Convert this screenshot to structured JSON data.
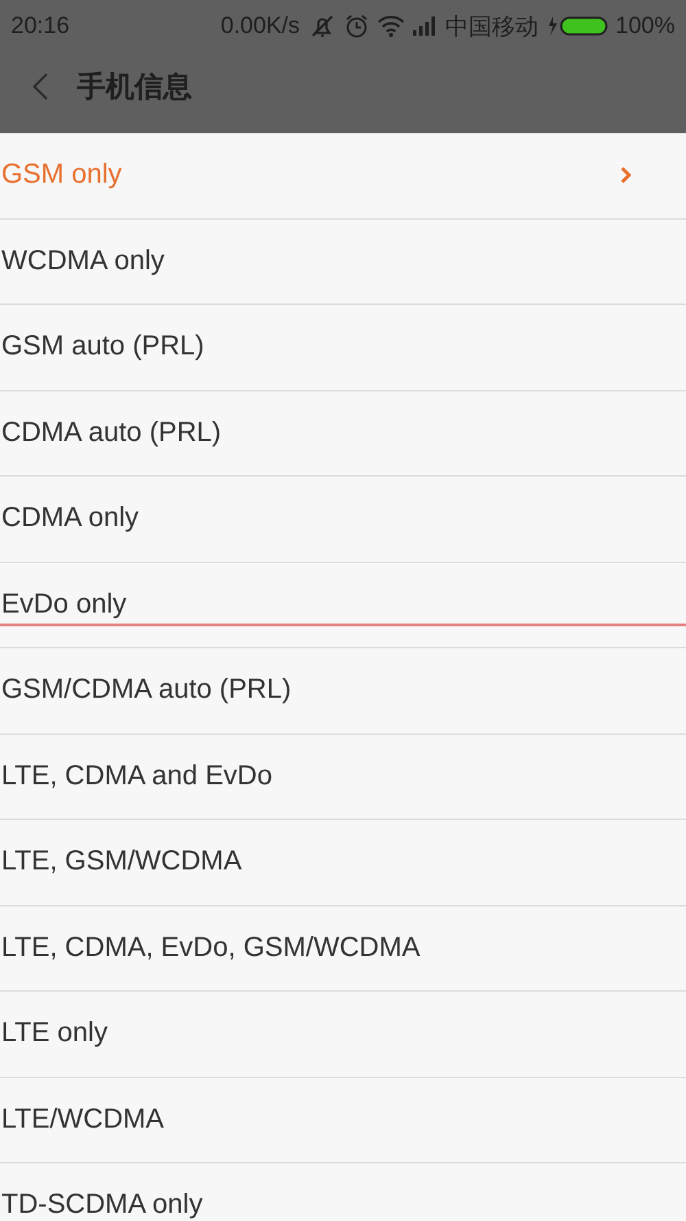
{
  "status_bar": {
    "time": "20:16",
    "speed": "0.00K/s",
    "carrier": "中国移动",
    "battery": "100%"
  },
  "header": {
    "title": "手机信息"
  },
  "options": [
    {
      "label": "GSM only",
      "selected": true
    },
    {
      "label": "WCDMA only",
      "selected": false
    },
    {
      "label": "GSM auto (PRL)",
      "selected": false
    },
    {
      "label": "CDMA auto (PRL)",
      "selected": false
    },
    {
      "label": "CDMA only",
      "selected": false
    },
    {
      "label": "EvDo only",
      "selected": false
    },
    {
      "label": "GSM/CDMA auto (PRL)",
      "selected": false
    },
    {
      "label": "LTE, CDMA and EvDo",
      "selected": false
    },
    {
      "label": "LTE, GSM/WCDMA",
      "selected": false
    },
    {
      "label": "LTE, CDMA, EvDo, GSM/WCDMA",
      "selected": false
    },
    {
      "label": "LTE only",
      "selected": false
    },
    {
      "label": "LTE/WCDMA",
      "selected": false
    },
    {
      "label": "TD-SCDMA only",
      "selected": false
    }
  ]
}
